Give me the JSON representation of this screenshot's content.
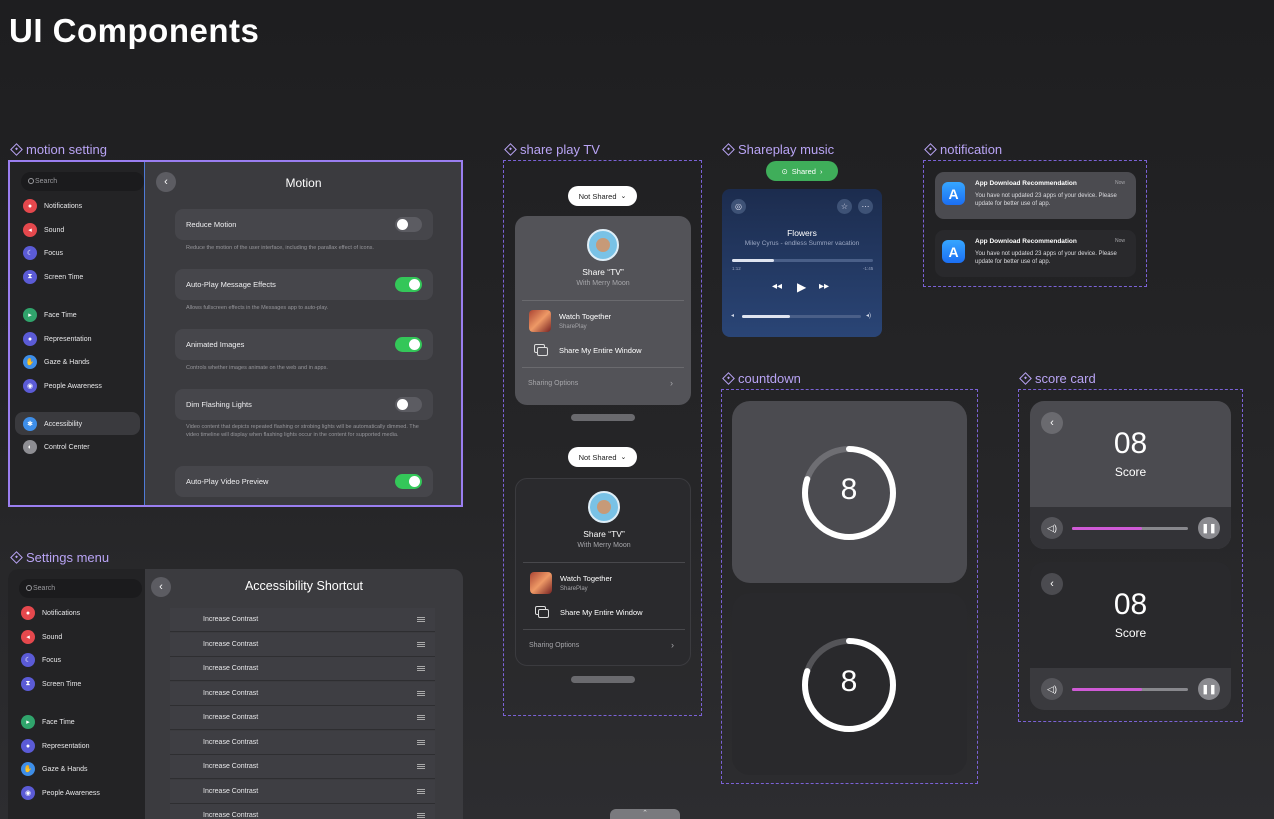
{
  "page": {
    "title": "UI Components"
  },
  "sections": {
    "motion": "motion setting",
    "settings": "Settings menu",
    "shareplay": "share play TV",
    "music": "Shareplay music",
    "notification": "notification",
    "countdown": "countdown",
    "score": "score card"
  },
  "sidebar": {
    "search": "Search",
    "items": [
      {
        "label": "Notifications",
        "color": "#e5484d",
        "icon": "bell-icon"
      },
      {
        "label": "Sound",
        "color": "#e5484d",
        "icon": "speaker-icon"
      },
      {
        "label": "Focus",
        "color": "#5b5bd6",
        "icon": "moon-icon"
      },
      {
        "label": "Screen Time",
        "color": "#5b5bd6",
        "icon": "hourglass-icon"
      },
      {
        "label": "Face Time",
        "color": "#30a46c",
        "icon": "video-icon"
      },
      {
        "label": "Representation",
        "color": "#5b5bd6",
        "icon": "person-icon"
      },
      {
        "label": "Gaze & Hands",
        "color": "#3e8ee8",
        "icon": "hand-icon"
      },
      {
        "label": "People Awareness",
        "color": "#5b5bd6",
        "icon": "people-icon"
      },
      {
        "label": "Accessibility",
        "color": "#3e8ee8",
        "icon": "accessibility-icon"
      },
      {
        "label": "Control Center",
        "color": "#8e8e93",
        "icon": "control-center-icon"
      }
    ]
  },
  "motion": {
    "title": "Motion",
    "rows": [
      {
        "label": "Reduce Motion",
        "on": false,
        "desc": "Reduce the motion of the user interface, including the parallax effect of icons."
      },
      {
        "label": "Auto-Play Message Effects",
        "on": true,
        "desc": "Allows fullscreen effects in the Messages app to auto-play."
      },
      {
        "label": "Animated Images",
        "on": true,
        "desc": "Controls whether images animate on the web and in apps."
      },
      {
        "label": "Dim Flashing Lights",
        "on": false,
        "desc": "Video content that depicts repeated flashing or strobing lights will be automatically dimmed. The video timeline will display when flashing lights occur in the content for supported media."
      },
      {
        "label": "Auto-Play Video Preview",
        "on": true,
        "desc": ""
      }
    ]
  },
  "settings": {
    "title": "Accessibility Shortcut",
    "rows": [
      "Increase Contrast",
      "Increase Contrast",
      "Increase Contrast",
      "Increase Contrast",
      "Increase Contrast",
      "Increase Contrast",
      "Increase Contrast",
      "Increase Contrast",
      "Increase Contrast"
    ]
  },
  "shareplay": {
    "pill": "Not Shared",
    "title": "Share “TV”",
    "subtitle": "With Merry Moon",
    "watch": "Watch Together",
    "watch_sub": "SharePlay",
    "window": "Share My Entire Window",
    "options": "Sharing Options"
  },
  "music": {
    "pill": "Shared",
    "song": "Flowers",
    "artist": "Miley Cyrus - endless Summer vacation",
    "elapsed": "1:12",
    "remaining": "-1:45",
    "progress": 0.3,
    "volume": 0.4
  },
  "notification": {
    "items": [
      {
        "title": "App Download Recommendation",
        "time": "Now",
        "body": "You have not updated 23 apps of your device. Please update for better use of app."
      },
      {
        "title": "App Download Recommendation",
        "time": "Now",
        "body": "You have not updated 23 apps of your device. Please update for better use of app."
      }
    ]
  },
  "countdown": {
    "items": [
      {
        "value": "8",
        "progress": 0.8
      },
      {
        "value": "8",
        "progress": 0.8
      }
    ]
  },
  "score": {
    "items": [
      {
        "value": "08",
        "label": "Score",
        "volume": 0.6
      },
      {
        "value": "08",
        "label": "Score",
        "volume": 0.6
      }
    ]
  }
}
